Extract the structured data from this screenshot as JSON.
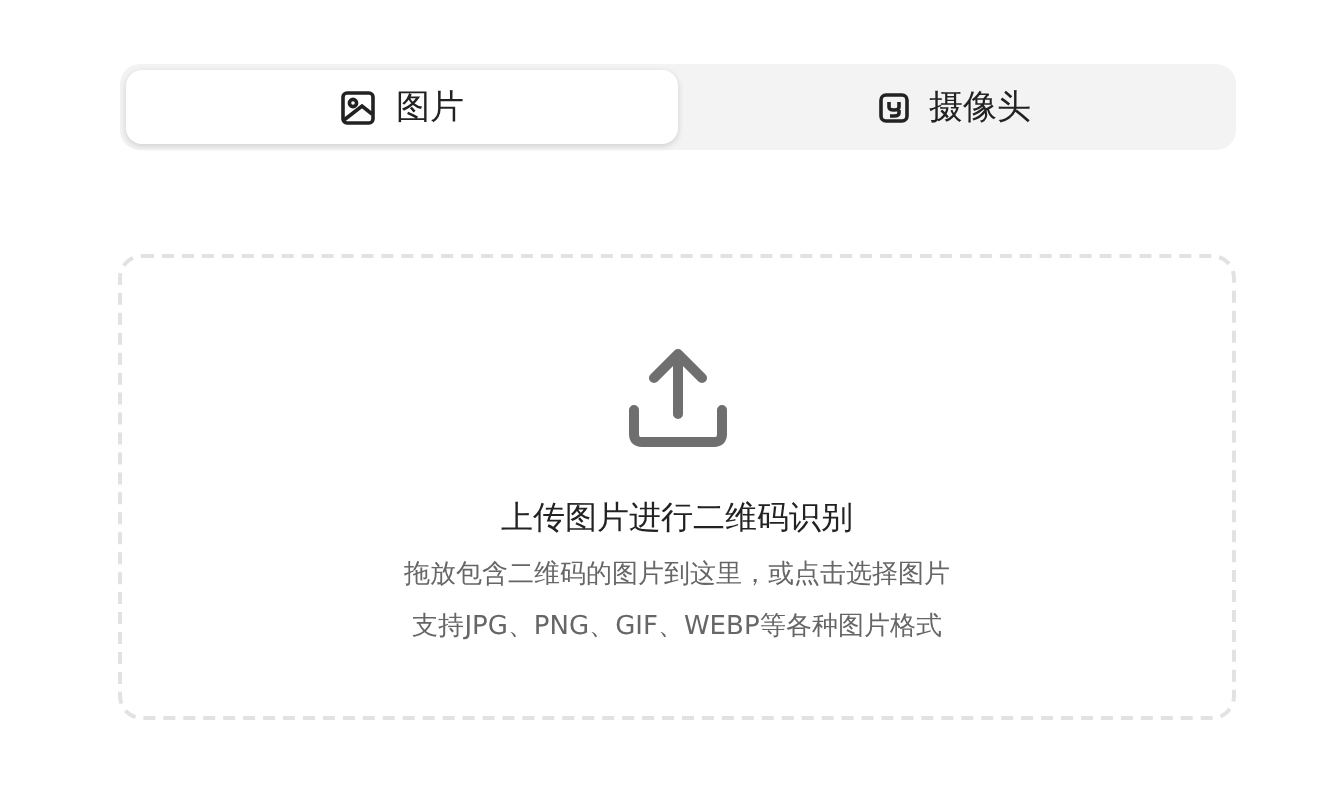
{
  "tabs": [
    {
      "label": "图片",
      "kind": "image",
      "selected": true
    },
    {
      "label": "摄像头",
      "kind": "camera",
      "selected": false
    }
  ],
  "dropzone": {
    "title": "上传图片进行二维码识别",
    "hint": "拖放包含二维码的图片到这里，或点击选择图片",
    "formats": "支持JPG、PNG、GIF、WEBP等各种图片格式"
  }
}
